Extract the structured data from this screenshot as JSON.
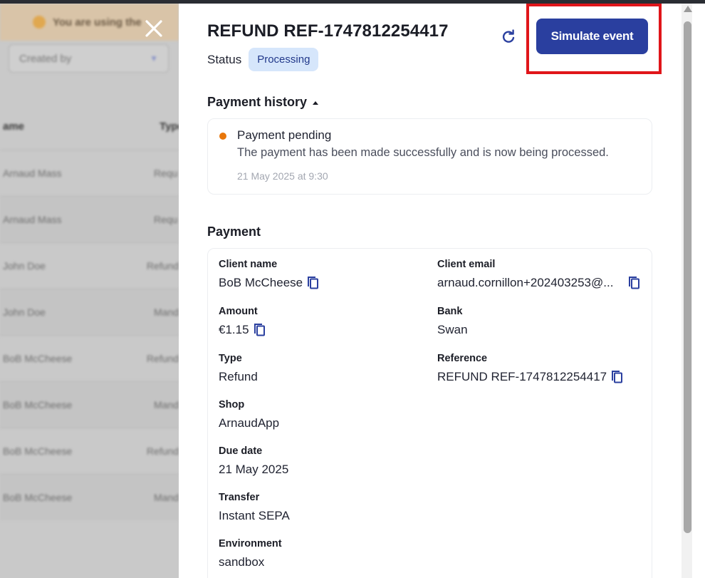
{
  "background": {
    "banner_text": "You are using the",
    "filter_select": "Created by",
    "table_headers": [
      "ame",
      "Type"
    ],
    "table_rows": [
      [
        "Arnaud Mass",
        "Requ"
      ],
      [
        "Arnaud Mass",
        "Requ"
      ],
      [
        "John Doe",
        "Refund"
      ],
      [
        "John Doe",
        "Mand"
      ],
      [
        "BoB McCheese",
        "Refund"
      ],
      [
        "BoB McCheese",
        "Mand"
      ],
      [
        "BoB McCheese",
        "Refund"
      ],
      [
        "BoB McCheese",
        "Mand"
      ]
    ]
  },
  "drawer": {
    "title": "REFUND REF-1747812254417",
    "status_label": "Status",
    "status_value": "Processing",
    "simulate_button": "Simulate event",
    "payment_history": {
      "heading": "Payment history",
      "entries": [
        {
          "title": "Payment pending",
          "description": "The payment has been made successfully and is now being processed.",
          "date": "21 May 2025 at 9:30",
          "status_color": "#e8760a"
        }
      ]
    },
    "payment": {
      "heading": "Payment",
      "client_name": {
        "label": "Client name",
        "value": "BoB McCheese"
      },
      "client_email": {
        "label": "Client email",
        "value": "arnaud.cornillon+202403253@..."
      },
      "amount": {
        "label": "Amount",
        "value": "€1.15"
      },
      "bank": {
        "label": "Bank",
        "value": "Swan"
      },
      "type": {
        "label": "Type",
        "value": "Refund"
      },
      "reference": {
        "label": "Reference",
        "value": "REFUND REF-1747812254417"
      },
      "shop": {
        "label": "Shop",
        "value": "ArnaudApp"
      },
      "due_date": {
        "label": "Due date",
        "value": "21 May 2025"
      },
      "transfer": {
        "label": "Transfer",
        "value": "Instant SEPA"
      },
      "environment": {
        "label": "Environment",
        "value": "sandbox"
      }
    }
  },
  "colors": {
    "primary": "#2a3f9f",
    "badge_bg": "#d6e6fb",
    "highlight": "#e0151a"
  }
}
